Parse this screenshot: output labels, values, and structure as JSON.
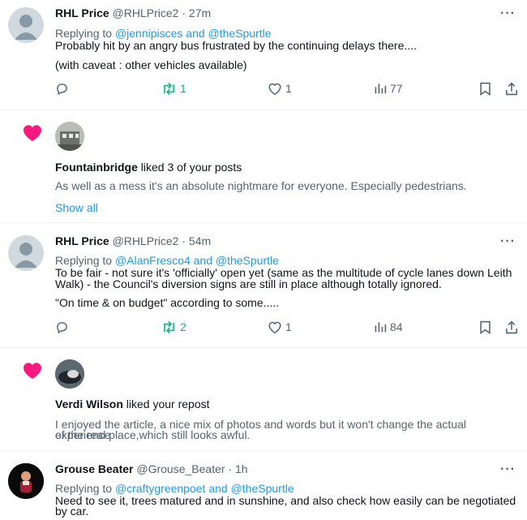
{
  "tweets": [
    {
      "name": "RHL Price",
      "handle": "@RHLPrice2",
      "time": "27m",
      "replying_prefix": "Replying to ",
      "replying_to": "@jennipisces and @theSpurtle",
      "lines": [
        "Probably hit by an angry bus frustrated by the continuing delays there....",
        "(with caveat : other vehicles available)"
      ],
      "retweets": "1",
      "likes": "1",
      "views": "77"
    },
    {
      "name": "RHL Price",
      "handle": "@RHLPrice2",
      "time": "54m",
      "replying_prefix": "Replying to ",
      "replying_to": "@AlanFresco4 and @theSpurtle",
      "lines": [
        "To be fair - not sure it's 'officially' open yet (same as the multitude of cycle lanes down Leith",
        "Walk) - the Council's diversion signs are still in place although totally ignored.",
        "\"On time & on budget\" according to some....."
      ],
      "retweets": "2",
      "likes": "1",
      "views": "84"
    },
    {
      "name": "Grouse Beater",
      "handle": "@Grouse_Beater",
      "time": "1h",
      "replying_prefix": "Replying to ",
      "replying_to": "@craftygreenpoet and @theSpurtle",
      "lines": [
        "Need to see it, trees matured and in sunshine, and also check how easily can be negotiated",
        "by car."
      ]
    }
  ],
  "notifications": [
    {
      "name": "Fountainbridge",
      "action": " liked 3 of your posts",
      "quote": "As well as a mess it's an absolute nightmare for everyone. Especially pedestrians.",
      "show_all": "Show all"
    },
    {
      "name": "Verdi Wilson",
      "action": " liked your repost",
      "quote_lines": [
        "I enjoyed the article, a nice mix of photos and words but it won't change the actual experience",
        "of the real place,which still looks awful."
      ]
    }
  ],
  "separator": " · ",
  "more_label": "···",
  "colors": {
    "link": "#1d9bf0",
    "retweet": "#00ba7c",
    "heart": "#f91880",
    "muted": "#536471"
  },
  "icons": [
    "reply-icon",
    "retweet-icon",
    "like-icon",
    "views-icon",
    "bookmark-icon",
    "share-icon",
    "heart-notification-icon",
    "more-icon"
  ]
}
